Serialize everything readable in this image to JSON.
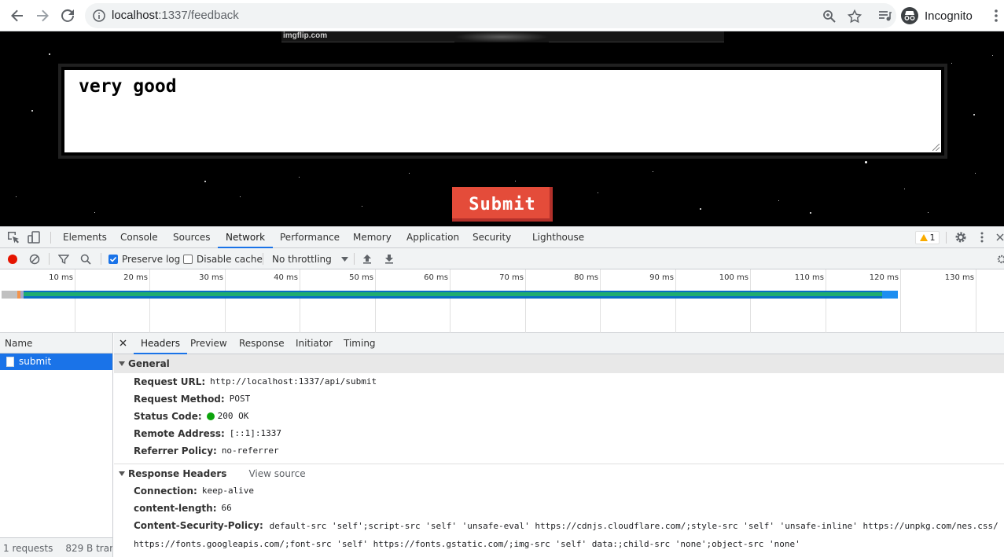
{
  "browser": {
    "url_host": "localhost",
    "url_path": ":1337/feedback",
    "profile_label": "Incognito"
  },
  "page": {
    "watermark": "imgflip.com",
    "feedback_value": "very good",
    "submit_label": "Submit"
  },
  "devtools": {
    "tabs": [
      "Elements",
      "Console",
      "Sources",
      "Network",
      "Performance",
      "Memory",
      "Application",
      "Security",
      "Lighthouse"
    ],
    "active_tab": "Network",
    "warning_count": "1",
    "toolbar": {
      "preserve_log": "Preserve log",
      "disable_cache": "Disable cache",
      "throttling": "No throttling"
    },
    "timeline_ticks": [
      "10 ms",
      "20 ms",
      "30 ms",
      "40 ms",
      "50 ms",
      "60 ms",
      "70 ms",
      "80 ms",
      "90 ms",
      "100 ms",
      "110 ms",
      "120 ms",
      "130 ms"
    ],
    "name_column": "Name",
    "request_name": "submit",
    "footer": {
      "requests": "1 requests",
      "transferred": "829 B tran"
    },
    "detail_tabs": [
      "Headers",
      "Preview",
      "Response",
      "Initiator",
      "Timing"
    ],
    "general": {
      "title": "General",
      "request_url_key": "Request URL:",
      "request_url": "http://localhost:1337/api/submit",
      "method_key": "Request Method:",
      "method": "POST",
      "status_key": "Status Code:",
      "status": "200 OK",
      "remote_key": "Remote Address:",
      "remote": "[::1]:1337",
      "referrer_key": "Referrer Policy:",
      "referrer": "no-referrer"
    },
    "response_headers": {
      "title": "Response Headers",
      "view_source": "View source",
      "connection_key": "Connection:",
      "connection": "keep-alive",
      "length_key": "content-length:",
      "length": "66",
      "csp_key": "Content-Security-Policy:",
      "csp": "default-src 'self';script-src 'self' 'unsafe-eval' https://cdnjs.cloudflare.com/;style-src 'self' 'unsafe-inline' https://unpkg.com/nes.css/ https://fonts.googleapis.com/;font-src 'self' https://fonts.gstatic.com/;img-src 'self' data:;child-src 'none';object-src 'none'"
    }
  }
}
